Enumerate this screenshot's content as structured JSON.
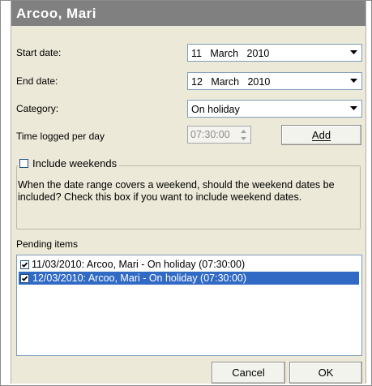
{
  "dialog": {
    "title": "Arcoo, Mari",
    "start_date": {
      "label": "Start date:",
      "value": "11   March   2010"
    },
    "end_date": {
      "label": "End date:",
      "value": "12   March   2010"
    },
    "category": {
      "label": "Category:",
      "value": "On holiday"
    },
    "time_logged": {
      "label": "Time logged per day",
      "value": "07:30:00"
    },
    "add_button": "Add",
    "include_weekends": {
      "label": "Include weekends",
      "checked": false,
      "description": "When the date range covers a weekend, should the weekend dates be included?  Check this box if you want to include weekend dates."
    },
    "pending": {
      "label": "Pending items",
      "items": [
        {
          "text": "11/03/2010: Arcoo, Mari - On holiday (07:30:00)",
          "checked": true,
          "selected": false
        },
        {
          "text": "12/03/2010: Arcoo, Mari - On holiday (07:30:00)",
          "checked": true,
          "selected": true
        }
      ]
    },
    "cancel_button": "Cancel",
    "ok_button": "OK"
  },
  "colors": {
    "title_bar": "#808080",
    "dialog_bg": "#ece9d8",
    "selection": "#316ac5"
  }
}
